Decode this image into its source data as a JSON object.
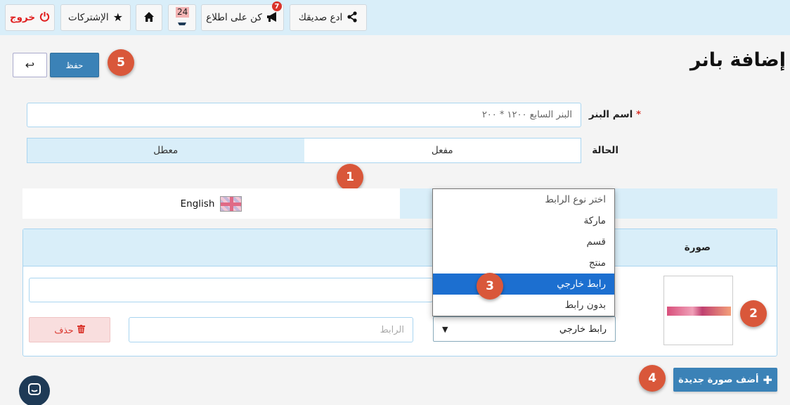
{
  "topbar": {
    "invite_label": "ادع صديقك",
    "notify_label": "كن على اطلاع",
    "notify_badge": "7",
    "messages_badge": "24",
    "subscriptions_label": "الإشتركات",
    "logout_label": "خروج"
  },
  "page": {
    "title": "إضافة بانر",
    "save_label": "حفظ",
    "back_icon": "↩"
  },
  "form": {
    "name_label": "اسم البنر",
    "required_mark": "*",
    "name_value": "البنر السابع ١٢٠٠ * ٢٠٠",
    "status_label": "الحالة",
    "status_enabled": "مفعل",
    "status_disabled": "معطل"
  },
  "lang_tabs": {
    "english_label": "English"
  },
  "images_panel": {
    "column_header": "صورة",
    "link_type_value": "رابط خارجي",
    "link_placeholder": "الرابط",
    "delete_label": "حذف",
    "add_label": "أضف صورة جديدة"
  },
  "link_type_options": [
    "اختر نوع الرابط",
    "ماركة",
    "قسم",
    "منتج",
    "رابط خارجي",
    "بدون رابط"
  ],
  "link_type_selected_index": 4,
  "steps": [
    "1",
    "2",
    "3",
    "4",
    "5"
  ],
  "colors": {
    "accent": "#3b82b7",
    "topbar": "#d9eef9",
    "step": "#d9573a",
    "danger": "#d9342b"
  }
}
